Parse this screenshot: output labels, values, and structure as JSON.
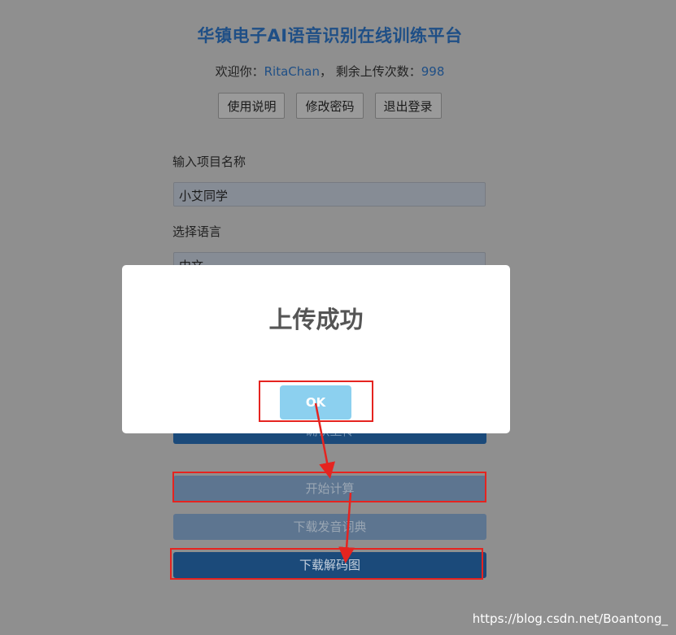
{
  "header": {
    "title": "华镇电子AI语音识别在线训练平台",
    "welcome_prefix": "欢迎你：",
    "username": "RitaChan",
    "remaining_prefix": "， 剩余上传次数：",
    "remaining_count": "998"
  },
  "nav_buttons": {
    "instructions": "使用说明",
    "change_password": "修改密码",
    "logout": "退出登录"
  },
  "form": {
    "project_label": "输入项目名称",
    "project_value": "小艾同学",
    "language_label": "选择语言",
    "language_value": "中文"
  },
  "actions": {
    "confirm_upload": "确认上传",
    "start_compute": "开始计算",
    "download_dict": "下载发音词典",
    "download_decode": "下载解码图"
  },
  "modal": {
    "title": "上传成功",
    "ok_label": "OK"
  },
  "watermark": "https://blog.csdn.net/Boantong_",
  "colors": {
    "annotation_red": "#e52420",
    "ok_button": "#8cd0ef",
    "primary_button": "#1b4a7a",
    "title_blue": "#1f4f86"
  }
}
